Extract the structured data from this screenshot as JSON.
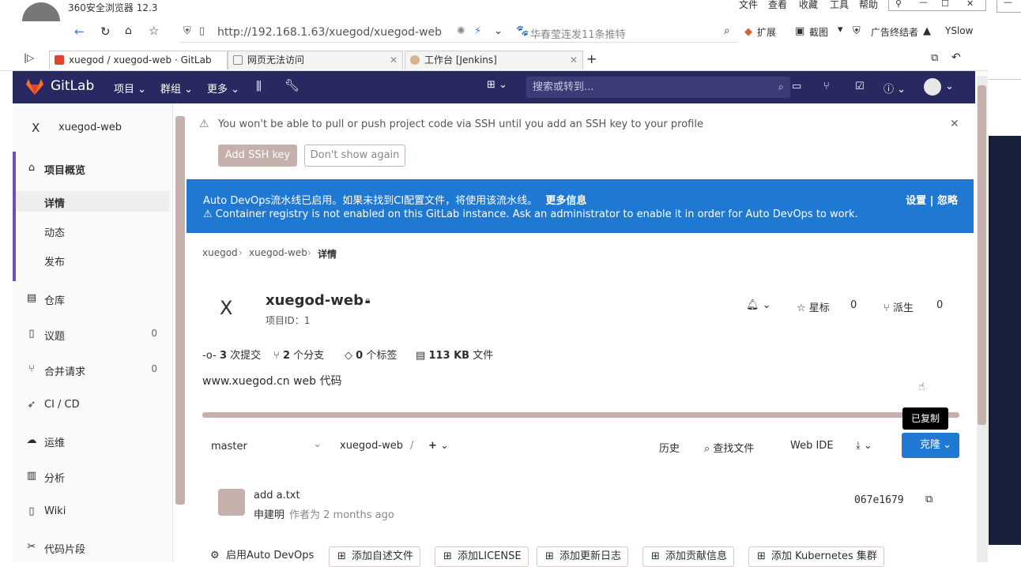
{
  "browser": {
    "title": "360安全浏览器 12.3",
    "menu": [
      "文件",
      "查看",
      "收藏",
      "工具",
      "帮助"
    ],
    "url": "http://192.168.1.63/xuegod/xuegod-web",
    "search_hint": "华春莹连发11条推特",
    "right_tools": [
      "扩展",
      "截图",
      "广告终结者",
      "YSlow"
    ],
    "tabs": [
      {
        "title": "xuegod / xuegod-web · GitLab"
      },
      {
        "title": "网页无法访问"
      },
      {
        "title": "工作台 [Jenkins]"
      }
    ],
    "new_tab": "+"
  },
  "gitlab": {
    "logo": "GitLab",
    "nav": [
      "项目",
      "群组",
      "更多"
    ],
    "search_placeholder": "搜索或转到..."
  },
  "sidebar": {
    "avatar_letter": "X",
    "project_name": "xuegod-web",
    "overview": "项目概览",
    "sub": [
      "详情",
      "动态",
      "发布"
    ],
    "items": [
      {
        "label": "仓库",
        "count": ""
      },
      {
        "label": "议题",
        "count": "0"
      },
      {
        "label": "合并请求",
        "count": "0"
      },
      {
        "label": "CI / CD",
        "count": ""
      },
      {
        "label": "运维",
        "count": ""
      },
      {
        "label": "分析",
        "count": ""
      },
      {
        "label": "Wiki",
        "count": ""
      },
      {
        "label": "代码片段",
        "count": ""
      }
    ]
  },
  "ssh_alert": {
    "message": "You won't be able to pull or push project code via SSH until you add an SSH key to your profile",
    "add_button": "Add SSH key",
    "dismiss_button": "Don't show again"
  },
  "devops_banner": {
    "line1": "Auto DevOps流水线已启用。如果未找到CI配置文件，将使用该流水线。",
    "more_info": "更多信息",
    "line2": "Container registry is not enabled on this GitLab instance. Ask an administrator to enable it in order for Auto DevOps to work.",
    "settings": "设置",
    "separator": "|",
    "dismiss": "忽略"
  },
  "breadcrumb": [
    "xuegod",
    "xuegod-web",
    "详情"
  ],
  "project": {
    "avatar_letter": "X",
    "name": "xuegod-web",
    "id_text": "项目ID：1",
    "star_label": "星标",
    "star_count": "0",
    "fork_label": "派生",
    "fork_count": "0",
    "stats": [
      {
        "num": "3",
        "label": "次提交"
      },
      {
        "num": "2",
        "label": "个分支"
      },
      {
        "num": "0",
        "label": "个标签"
      },
      {
        "num": "113 KB",
        "label": "文件"
      }
    ],
    "description": "www.xuegod.cn web 代码",
    "progress": 1.0
  },
  "repo_toolbar": {
    "branch": "master",
    "path": "xuegod-web",
    "path_sep": "/",
    "add": "+",
    "history": "历史",
    "find_file": "查找文件",
    "web_ide": "Web IDE",
    "clone": "克隆",
    "tooltip": "已复制"
  },
  "last_commit": {
    "title": "add a.txt",
    "author": "申建明",
    "meta": "作者为 2 months ago",
    "sha": "067e1679"
  },
  "quick_actions": [
    "启用Auto DevOps",
    "添加自述文件",
    "添加LICENSE",
    "添加更新日志",
    "添加贡献信息",
    "添加 Kubernetes 集群"
  ],
  "colors": {
    "gitlab_header": "#292961",
    "banner_blue": "#1f78d1",
    "accent_tan": "#c5b0ac"
  }
}
